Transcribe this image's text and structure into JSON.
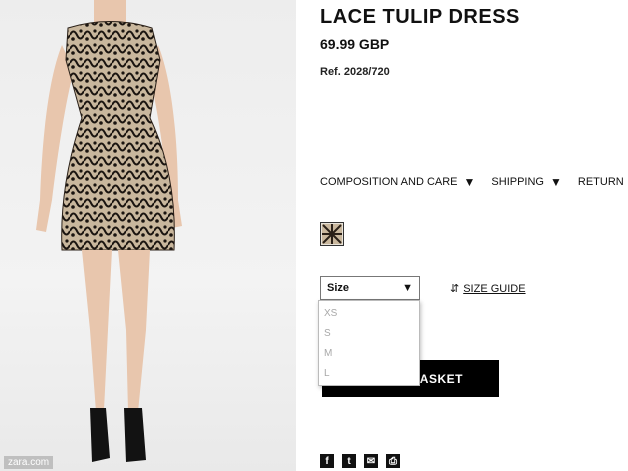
{
  "product": {
    "title": "LACE TULIP DRESS",
    "price": "69.99 GBP",
    "ref": "Ref. 2028/720"
  },
  "tabs": [
    {
      "label": "COMPOSITION AND CARE",
      "icon": "caret-down-icon"
    },
    {
      "label": "SHIPPING",
      "icon": "caret-down-icon"
    },
    {
      "label": "RETURN",
      "icon": "caret-down-icon"
    }
  ],
  "size": {
    "placeholder": "Size",
    "options": [
      "XS",
      "S",
      "M",
      "L"
    ],
    "guide_label": "SIZE GUIDE"
  },
  "add_to_basket_label": "ADD TO BASKET",
  "watermark": "zara.com",
  "share_icons": [
    "facebook-icon",
    "twitter-icon",
    "email-icon",
    "print-icon"
  ],
  "colors": {
    "button": "#000000",
    "dropdown_text": "#a8a8a8"
  }
}
